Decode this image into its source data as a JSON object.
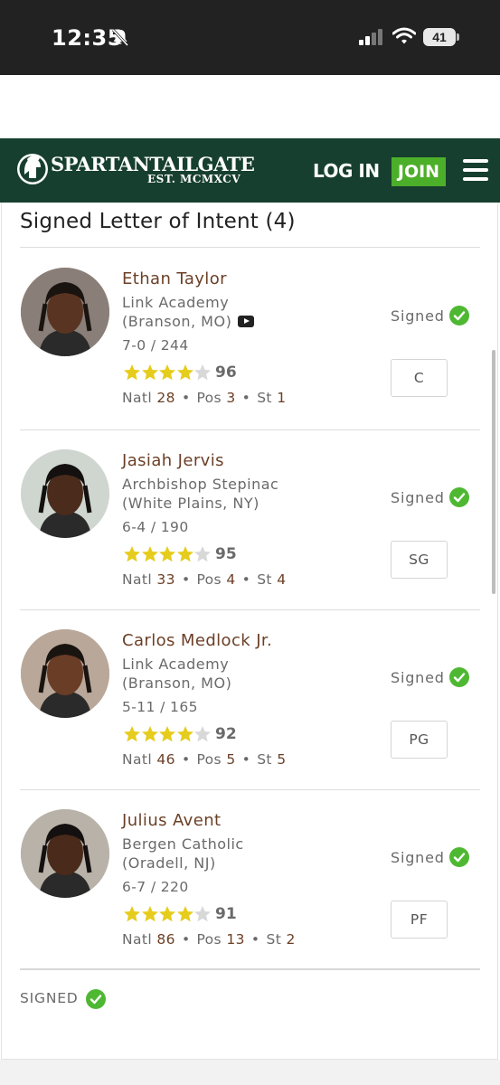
{
  "status_bar": {
    "time": "12:35",
    "battery": "41"
  },
  "header": {
    "brand": "SPARTANTAILGATE",
    "brand_sub": "EST. MCMXCV",
    "login_label": "LOG IN",
    "join_label": "JOIN"
  },
  "section": {
    "title": "Signed Letter of Intent (4)"
  },
  "players": [
    {
      "name": "Ethan Taylor",
      "school": "Link Academy",
      "location": "(Branson, MO)",
      "has_video": true,
      "measure": "7-0 / 244",
      "stars": 4,
      "rating": "96",
      "natl": "28",
      "pos_rank": "3",
      "st": "1",
      "status": "Signed",
      "position": "C"
    },
    {
      "name": "Jasiah Jervis",
      "school": "Archbishop Stepinac",
      "location": "(White Plains, NY)",
      "has_video": false,
      "measure": "6-4 / 190",
      "stars": 4,
      "rating": "95",
      "natl": "33",
      "pos_rank": "4",
      "st": "4",
      "status": "Signed",
      "position": "SG"
    },
    {
      "name": "Carlos Medlock Jr.",
      "school": "Link Academy",
      "location": "(Branson, MO)",
      "has_video": false,
      "measure": "5-11 / 165",
      "stars": 4,
      "rating": "92",
      "natl": "46",
      "pos_rank": "5",
      "st": "5",
      "status": "Signed",
      "position": "PG"
    },
    {
      "name": "Julius Avent",
      "school": "Bergen Catholic",
      "location": "(Oradell, NJ)",
      "has_video": false,
      "measure": "6-7 / 220",
      "stars": 4,
      "rating": "91",
      "natl": "86",
      "pos_rank": "13",
      "st": "2",
      "status": "Signed",
      "position": "PF"
    }
  ],
  "labels": {
    "natl": "Natl",
    "pos": "Pos",
    "st": "St",
    "dot": "•"
  },
  "footer": {
    "signed_label": "SIGNED"
  },
  "colors": {
    "header_bg": "#173f2f",
    "join_bg": "#4caf2a",
    "name_color": "#6b3f26",
    "star_gold": "#e6cc1c",
    "check_green": "#4fb833"
  }
}
